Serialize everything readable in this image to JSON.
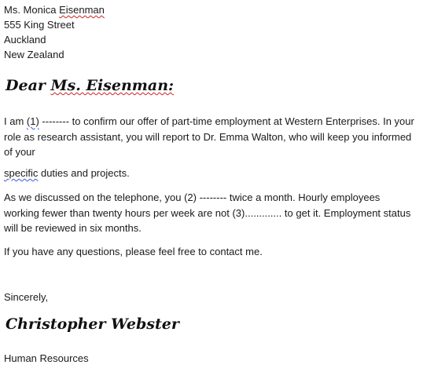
{
  "address": {
    "name_prefix": "Ms. Monica ",
    "name_surname": "Eisenman",
    "street": "555 King Street",
    "city": "Auckland",
    "country": "New Zealand"
  },
  "salutation": {
    "prefix": "Dear ",
    "name": "Ms. Eisenman:"
  },
  "body": {
    "p1_start": "I am ",
    "p1_blank": "(1)",
    "p1_rest": " -------- to confirm our offer of part-time employment at Western Enterprises. In your role as research assistant, you will report to Dr. Emma Walton, who will keep you informed of your",
    "p2_word": "specific",
    "p2_rest": " duties and projects.",
    "p3": "As we discussed on the telephone, you (2) -------- twice a month. Hourly employees working fewer than twenty hours per week are not (3)............. to get it. Employment status will be reviewed in six months.",
    "p4": "If you have any questions, please feel free to contact me."
  },
  "closing": "Sincerely,",
  "signature": "Christopher Webster",
  "department": "Human Resources"
}
